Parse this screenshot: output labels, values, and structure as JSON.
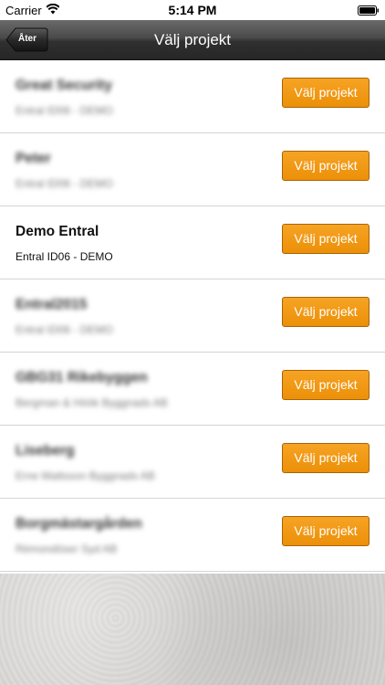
{
  "status_bar": {
    "carrier": "Carrier",
    "time": "5:14 PM",
    "icons": [
      "wifi-icon",
      "battery-icon"
    ]
  },
  "navbar": {
    "back_label": "Åter",
    "title": "Välj projekt"
  },
  "projects": [
    {
      "title": "Great Security",
      "subtitle": "Entral ID06 - DEMO",
      "button_label": "Välj projekt",
      "blurred": true
    },
    {
      "title": "Peter",
      "subtitle": "Entral ID06 - DEMO",
      "button_label": "Välj projekt",
      "blurred": true
    },
    {
      "title": "Demo Entral",
      "subtitle": "Entral ID06 - DEMO",
      "button_label": "Välj projekt",
      "blurred": false
    },
    {
      "title": "Entral2015",
      "subtitle": "Entral ID06 - DEMO",
      "button_label": "Välj projekt",
      "blurred": true
    },
    {
      "title": "GBG31 Rikebyggen",
      "subtitle": "Bergman & Höök Byggnads AB",
      "button_label": "Välj projekt",
      "blurred": true
    },
    {
      "title": "Liseberg",
      "subtitle": "Erne Mattsson Byggnads AB",
      "button_label": "Välj projekt",
      "blurred": true
    },
    {
      "title": "Borgmästargården",
      "subtitle": "Rémondöser Syd AB",
      "button_label": "Välj projekt",
      "blurred": true
    }
  ],
  "colors": {
    "accent": "#f09a14",
    "navbar": "#3a3a3a"
  }
}
